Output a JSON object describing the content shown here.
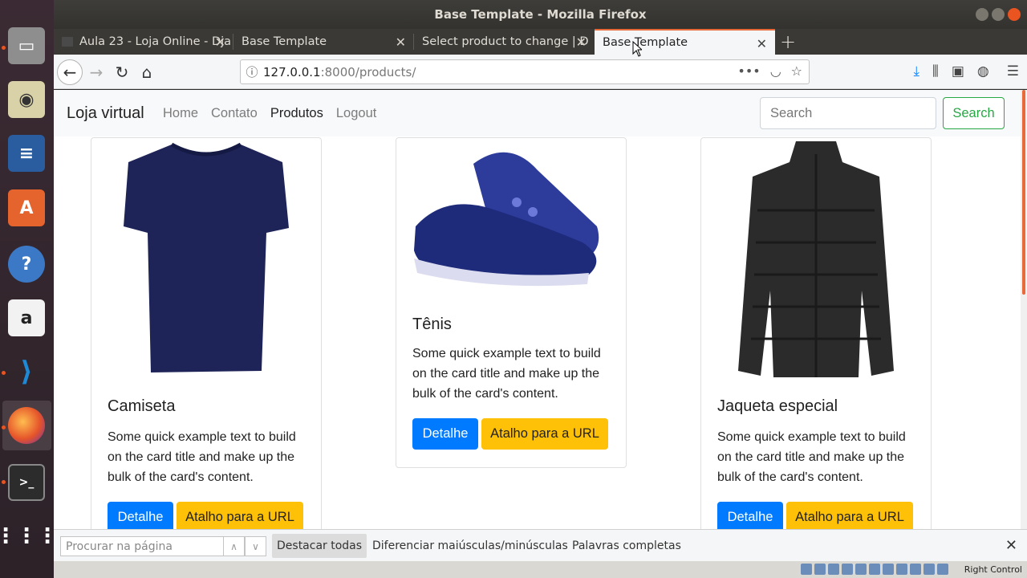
{
  "window": {
    "title": "Base Template - Mozilla Firefox"
  },
  "tabs": [
    {
      "label": "Aula 23 - Loja Online - Dja",
      "active": false
    },
    {
      "label": "Base Template",
      "active": false
    },
    {
      "label": "Select product to change | D",
      "active": false
    },
    {
      "label": "Base Template",
      "active": true
    }
  ],
  "address": {
    "host": "127.0.0.1",
    "path": ":8000/products/"
  },
  "site": {
    "brand": "Loja virtual",
    "nav": [
      "Home",
      "Contato",
      "Produtos",
      "Logout"
    ],
    "active_nav": "Produtos",
    "search_placeholder": "Search",
    "search_button": "Search"
  },
  "products": [
    {
      "title": "Camiseta",
      "text": "Some quick example text to build on the card title and make up the bulk of the card's content.",
      "detail": "Detalhe",
      "url_button": "Atalho para a URL",
      "image": "tshirt"
    },
    {
      "title": "Tênis",
      "text": "Some quick example text to build on the card title and make up the bulk of the card's content.",
      "detail": "Detalhe",
      "url_button": "Atalho para a URL",
      "image": "sneaker"
    },
    {
      "title": "Jaqueta especial",
      "text": "Some quick example text to build on the card title and make up the bulk of the card's content.",
      "detail": "Detalhe",
      "url_button": "Atalho para a URL",
      "image": "jacket"
    }
  ],
  "findbar": {
    "placeholder": "Procurar na página",
    "highlight_all": "Destacar todas",
    "match_case": "Diferenciar maiúsculas/minúsculas",
    "whole_words": "Palavras completas"
  },
  "vm": {
    "host_key": "Right Control"
  },
  "colors": {
    "primary": "#007bff",
    "warning": "#ffc107",
    "success": "#28a745",
    "ubuntu_orange": "#e95420"
  }
}
